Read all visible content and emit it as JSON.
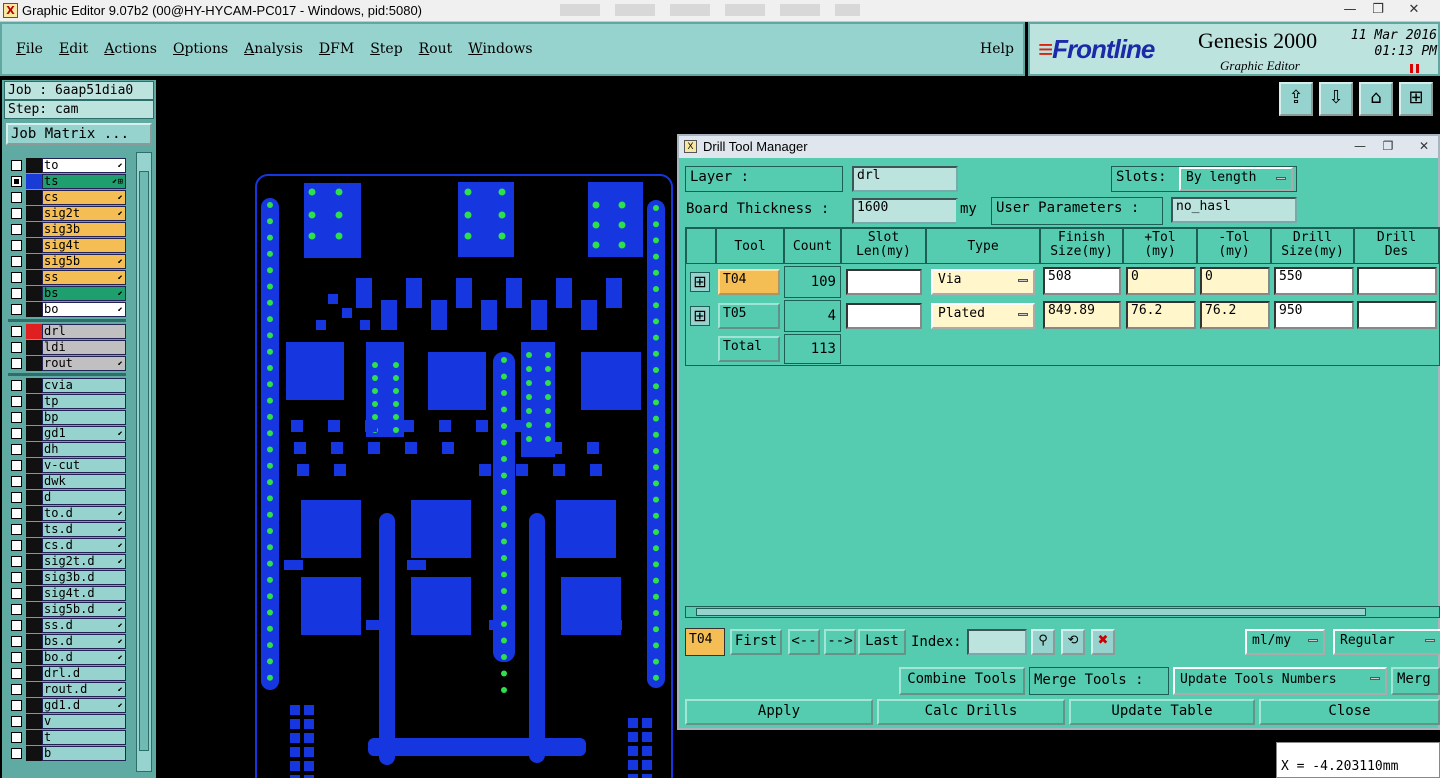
{
  "window": {
    "title": "Graphic Editor 9.07b2 (00@HY-HYCAM-PC017 - Windows, pid:5080)",
    "app_icon": "X",
    "minimize": "—",
    "restore": "❐",
    "close": "✕"
  },
  "menu": {
    "items": [
      "File",
      "Edit",
      "Actions",
      "Options",
      "Analysis",
      "DFM",
      "Step",
      "Rout",
      "Windows"
    ],
    "help": "Help"
  },
  "brand": {
    "logo": "Frontline",
    "product": "Genesis 2000",
    "subtitle": "Graphic Editor",
    "date": "11 Mar 2016",
    "time": "01:13 PM"
  },
  "left": {
    "job": "Job : 6aap51dia0",
    "step": "Step: cam",
    "job_matrix": "Job Matrix ...",
    "layers_a": [
      {
        "name": "to",
        "color": "#ffffff",
        "swatch": "#111111",
        "mark": "⬋"
      },
      {
        "name": "ts",
        "color": "#1f9e6e",
        "swatch": "#1a3cd6",
        "mark": "⬋⊞",
        "checked": true
      },
      {
        "name": "cs",
        "color": "#f5be55",
        "swatch": "#111111",
        "mark": "⬋"
      },
      {
        "name": "sig2t",
        "color": "#f5be55",
        "swatch": "#111111",
        "mark": "⬋"
      },
      {
        "name": "sig3b",
        "color": "#f5be55",
        "swatch": "#111111",
        "mark": ""
      },
      {
        "name": "sig4t",
        "color": "#f5be55",
        "swatch": "#111111",
        "mark": ""
      },
      {
        "name": "sig5b",
        "color": "#f5be55",
        "swatch": "#111111",
        "mark": "⬋"
      },
      {
        "name": "ss",
        "color": "#f5be55",
        "swatch": "#111111",
        "mark": "⬋"
      },
      {
        "name": "bs",
        "color": "#1f9e6e",
        "swatch": "#111111",
        "mark": "⬋"
      },
      {
        "name": "bo",
        "color": "#ffffff",
        "swatch": "#111111",
        "mark": "⬋"
      }
    ],
    "layers_b": [
      {
        "name": "drl",
        "color": "#c0c0c0",
        "swatch": "#e02020",
        "mark": ""
      },
      {
        "name": "ldi",
        "color": "#c0c0c0",
        "swatch": "#111111",
        "mark": ""
      },
      {
        "name": "rout",
        "color": "#c0c0c0",
        "swatch": "#111111",
        "mark": "⬋"
      }
    ],
    "layers_c": [
      {
        "name": "cvia",
        "mark": ""
      },
      {
        "name": "tp",
        "mark": ""
      },
      {
        "name": "bp",
        "mark": ""
      },
      {
        "name": "gd1",
        "mark": "⬋"
      },
      {
        "name": "dh",
        "mark": ""
      },
      {
        "name": "v-cut",
        "mark": ""
      },
      {
        "name": "dwk",
        "mark": ""
      },
      {
        "name": "d",
        "mark": ""
      },
      {
        "name": "to.d",
        "mark": "⬋"
      },
      {
        "name": "ts.d",
        "mark": "⬋"
      },
      {
        "name": "cs.d",
        "mark": "⬋"
      },
      {
        "name": "sig2t.d",
        "mark": "⬋"
      },
      {
        "name": "sig3b.d",
        "mark": ""
      },
      {
        "name": "sig4t.d",
        "mark": ""
      },
      {
        "name": "sig5b.d",
        "mark": "⬋"
      },
      {
        "name": "ss.d",
        "mark": "⬋"
      },
      {
        "name": "bs.d",
        "mark": "⬋"
      },
      {
        "name": "bo.d",
        "mark": "⬋"
      },
      {
        "name": "drl.d",
        "mark": ""
      },
      {
        "name": "rout.d",
        "mark": "⬋"
      },
      {
        "name": "gd1.d",
        "mark": "⬋"
      },
      {
        "name": "v",
        "mark": ""
      },
      {
        "name": "t",
        "mark": ""
      },
      {
        "name": "b",
        "mark": ""
      }
    ]
  },
  "icons": [
    "export-icon",
    "import-icon",
    "home-icon",
    "window-icon"
  ],
  "coords": {
    "x": "X = -4.203110mm"
  },
  "dialog": {
    "title": "Drill Tool Manager",
    "layer_label": "Layer         :",
    "layer_value": "drl",
    "slots_label": "Slots:",
    "slots_value": "By length",
    "thickness_label": "Board Thickness :",
    "thickness_value": "1600",
    "thickness_unit": "my",
    "user_params_label": "User Parameters :",
    "user_params_value": "no_hasl",
    "headers": [
      "Tool",
      "Count",
      "Slot\nLen(my)",
      "Type",
      "Finish\nSize(my)",
      "+Tol\n(my)",
      "-Tol\n(my)",
      "Drill\nSize(my)",
      "Drill\nDes"
    ],
    "rows": [
      {
        "tool": "T04",
        "count": "109",
        "slot_len": "",
        "type": "Via",
        "finish": "508",
        "ptol": "0",
        "mtol": "0",
        "drill": "550",
        "des": ""
      },
      {
        "tool": "T05",
        "count": "4",
        "slot_len": "",
        "type": "Plated",
        "finish": "849.89",
        "ptol": "76.2",
        "mtol": "76.2",
        "drill": "950",
        "des": ""
      }
    ],
    "total_label": "Total",
    "total_count": "113",
    "nav": {
      "current": "T04",
      "first": "First",
      "prev": "<--",
      "next": "-->",
      "last": "Last",
      "index_label": "Index:",
      "units": "ml/my",
      "mode": "Regular"
    },
    "combine": "Combine Tools",
    "merge_label": "Merge Tools :",
    "merge_value": "Update Tools Numbers",
    "merge_cut": "Merg",
    "apply": "Apply",
    "calc": "Calc Drills",
    "update": "Update Table",
    "close": "Close"
  }
}
